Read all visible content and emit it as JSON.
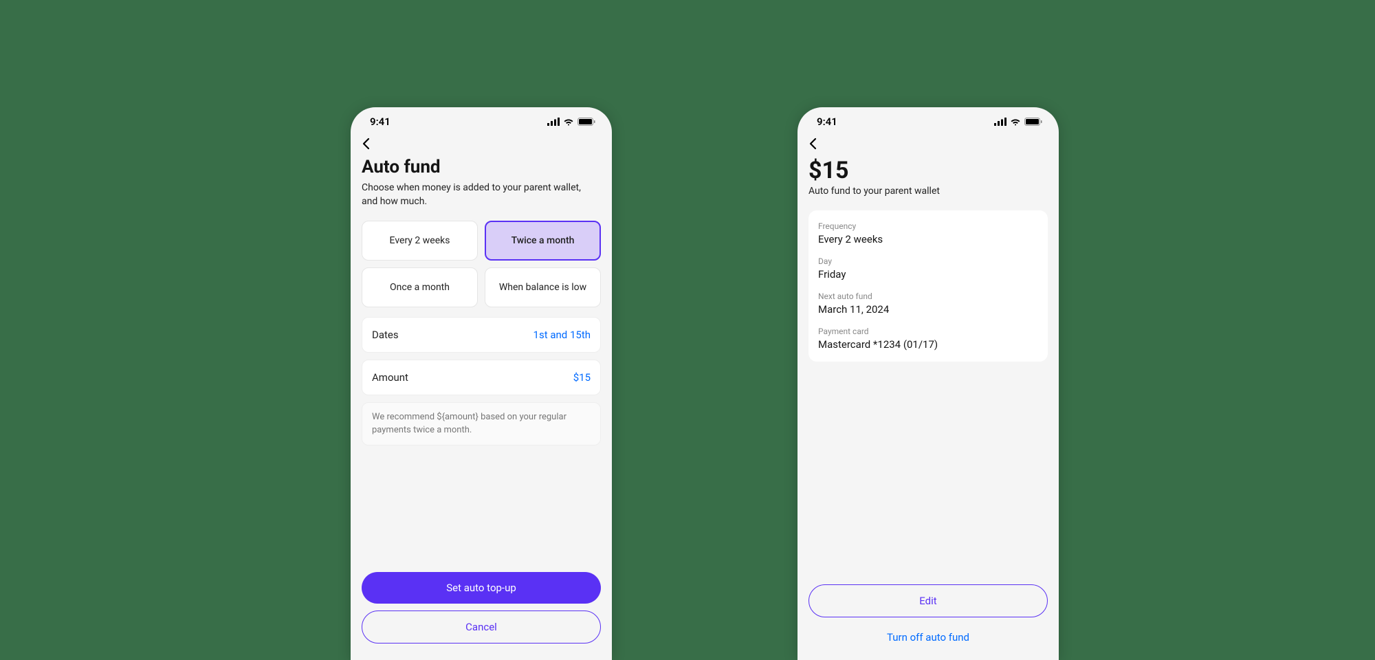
{
  "status": {
    "time": "9:41"
  },
  "screen1": {
    "title": "Auto fund",
    "subtitle": "Choose when money is added to your parent wallet, and how much.",
    "freq": {
      "opt1": "Every 2 weeks",
      "opt2": "Twice a month",
      "opt3": "Once a month",
      "opt4": "When balance is low"
    },
    "dates_label": "Dates",
    "dates_value": "1st and 15th",
    "amount_label": "Amount",
    "amount_value": "$15",
    "info": "We recommend ${amount} based on your regular payments twice a month.",
    "primary": "Set auto top-up",
    "secondary": "Cancel"
  },
  "screen2": {
    "amount": "$15",
    "subtitle": "Auto fund to your parent wallet",
    "rows": {
      "freq_label": "Frequency",
      "freq_value": "Every 2 weeks",
      "day_label": "Day",
      "day_value": "Friday",
      "next_label": "Next auto fund",
      "next_value": "March 11, 2024",
      "card_label": "Payment card",
      "card_value": "Mastercard *1234 (01/17)"
    },
    "edit": "Edit",
    "turn_off": "Turn off auto fund"
  }
}
